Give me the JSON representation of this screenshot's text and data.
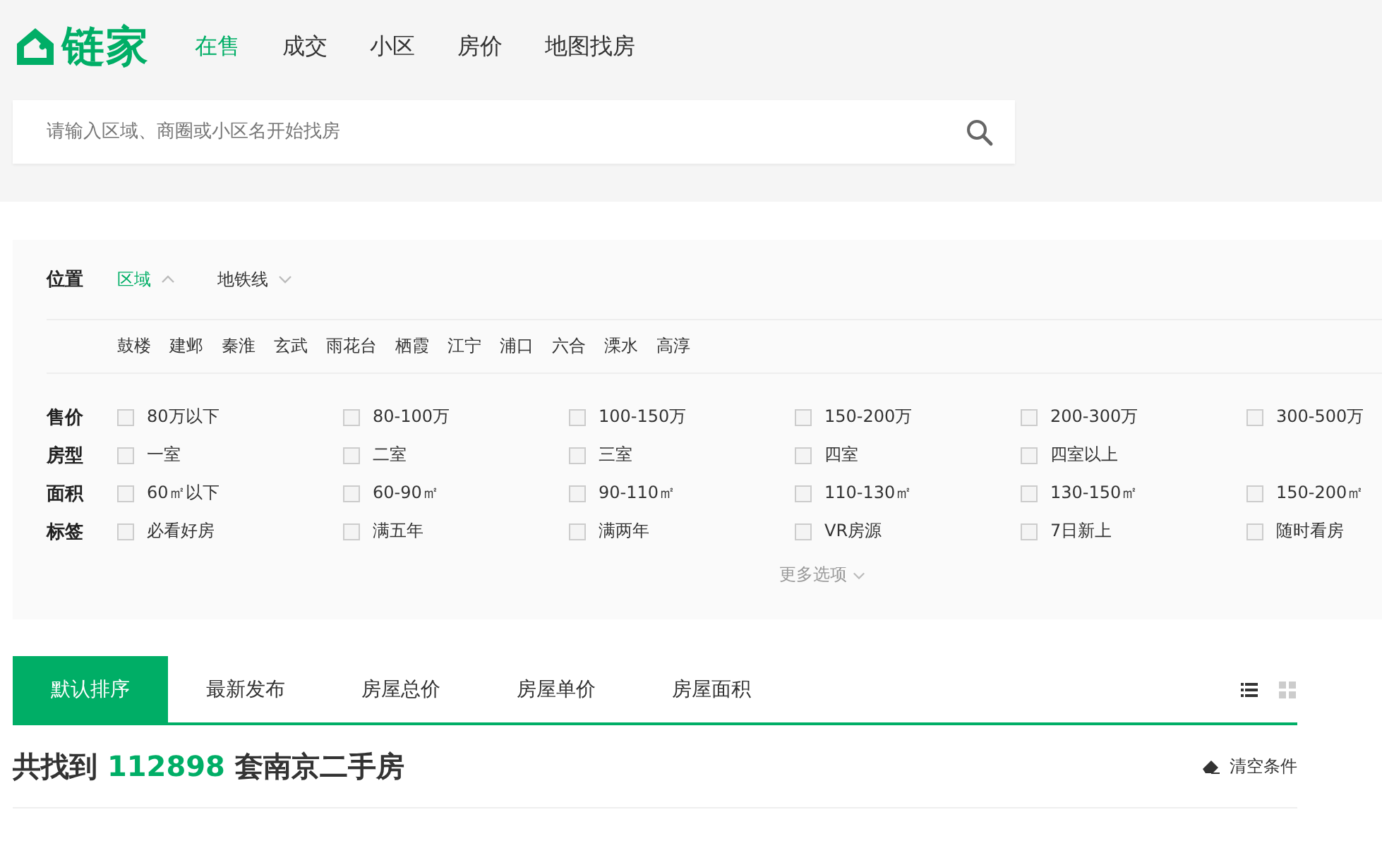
{
  "logo": {
    "text": "链家"
  },
  "nav": [
    {
      "label": "在售",
      "selected": true
    },
    {
      "label": "成交",
      "selected": false
    },
    {
      "label": "小区",
      "selected": false
    },
    {
      "label": "房价",
      "selected": false
    },
    {
      "label": "地图找房",
      "selected": false
    }
  ],
  "search": {
    "placeholder": "请输入区域、商圈或小区名开始找房"
  },
  "location": {
    "label": "位置",
    "tabs": [
      {
        "label": "区域",
        "selected": true,
        "expanded": true
      },
      {
        "label": "地铁线",
        "selected": false,
        "expanded": false
      }
    ],
    "districts": [
      "鼓楼",
      "建邺",
      "秦淮",
      "玄武",
      "雨花台",
      "栖霞",
      "江宁",
      "浦口",
      "六合",
      "溧水",
      "高淳"
    ]
  },
  "filters": [
    {
      "label": "售价",
      "options": [
        {
          "label": "80万以下",
          "checked": false
        },
        {
          "label": "80-100万",
          "checked": false
        },
        {
          "label": "100-150万",
          "checked": false
        },
        {
          "label": "150-200万",
          "checked": false
        },
        {
          "label": "200-300万",
          "checked": false
        },
        {
          "label": "300-500万",
          "checked": false
        }
      ]
    },
    {
      "label": "房型",
      "options": [
        {
          "label": "一室",
          "checked": false
        },
        {
          "label": "二室",
          "checked": false
        },
        {
          "label": "三室",
          "checked": false
        },
        {
          "label": "四室",
          "checked": false
        },
        {
          "label": "四室以上",
          "checked": false
        }
      ]
    },
    {
      "label": "面积",
      "options": [
        {
          "label": "60㎡以下",
          "checked": false
        },
        {
          "label": "60-90㎡",
          "checked": false
        },
        {
          "label": "90-110㎡",
          "checked": false
        },
        {
          "label": "110-130㎡",
          "checked": false
        },
        {
          "label": "130-150㎡",
          "checked": false
        },
        {
          "label": "150-200㎡",
          "checked": false
        }
      ]
    },
    {
      "label": "标签",
      "options": [
        {
          "label": "必看好房",
          "checked": false
        },
        {
          "label": "满五年",
          "checked": false
        },
        {
          "label": "满两年",
          "checked": false
        },
        {
          "label": "VR房源",
          "checked": false
        },
        {
          "label": "7日新上",
          "checked": false
        },
        {
          "label": "随时看房",
          "checked": false
        }
      ]
    }
  ],
  "more_options": "更多选项",
  "sort_tabs": [
    {
      "label": "默认排序",
      "selected": true
    },
    {
      "label": "最新发布",
      "selected": false
    },
    {
      "label": "房屋总价",
      "selected": false
    },
    {
      "label": "房屋单价",
      "selected": false
    },
    {
      "label": "房屋面积",
      "selected": false
    }
  ],
  "view_modes": [
    {
      "kind": "list",
      "selected": true
    },
    {
      "kind": "grid",
      "selected": false
    }
  ],
  "result": {
    "prefix": "共找到",
    "count": "112898",
    "suffix": "套南京二手房"
  },
  "clear_button": "清空条件"
}
